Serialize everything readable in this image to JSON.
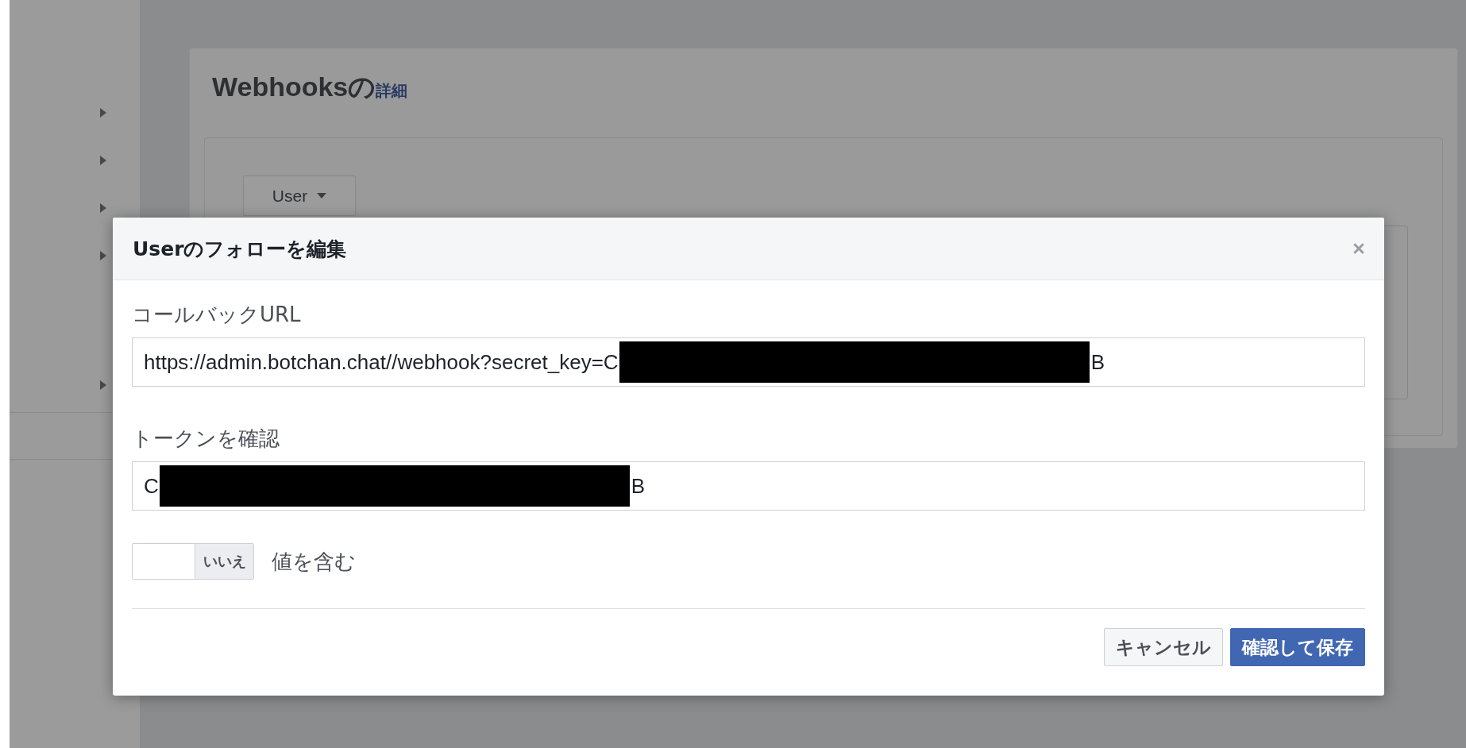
{
  "sidebar": {
    "items": [
      {
        "expanded": false
      },
      {
        "expanded": false
      },
      {
        "expanded": false
      },
      {
        "expanded": false
      },
      {
        "expanded": false
      }
    ]
  },
  "card": {
    "title": "Webhooksの",
    "title_link": "詳細",
    "object_dropdown": "User"
  },
  "dialog": {
    "title": "Userのフォローを編集",
    "fields": [
      {
        "label": "コールバックURL",
        "value_before": "https://admin.botchan.chat//webhook?secret_key=C",
        "value_after": "B"
      },
      {
        "label": "トークンを確認",
        "value_before": "C",
        "value_after": "B"
      }
    ],
    "toggle": {
      "on": false,
      "state_label": "いいえ",
      "label": "値を含む"
    },
    "buttons": [
      {
        "label": "キャンセル",
        "kind": "secondary"
      },
      {
        "label": "確認して保存",
        "kind": "primary"
      }
    ]
  }
}
